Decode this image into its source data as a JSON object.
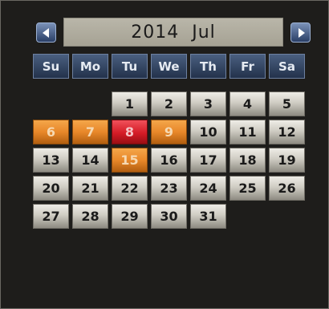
{
  "header": {
    "year": "2014",
    "month": "Jul"
  },
  "weekdays": [
    "Su",
    "Mo",
    "Tu",
    "We",
    "Th",
    "Fr",
    "Sa"
  ],
  "colors": {
    "highlight_orange": "#e8882a",
    "selected_red": "#d41c26"
  },
  "weeks": [
    [
      null,
      null,
      {
        "day": "1"
      },
      {
        "day": "2"
      },
      {
        "day": "3"
      },
      {
        "day": "4"
      },
      {
        "day": "5"
      }
    ],
    [
      {
        "day": "6",
        "state": "orange"
      },
      {
        "day": "7",
        "state": "orange"
      },
      {
        "day": "8",
        "state": "red"
      },
      {
        "day": "9",
        "state": "orange"
      },
      {
        "day": "10"
      },
      {
        "day": "11"
      },
      {
        "day": "12"
      }
    ],
    [
      {
        "day": "13"
      },
      {
        "day": "14"
      },
      {
        "day": "15",
        "state": "orange"
      },
      {
        "day": "16"
      },
      {
        "day": "17"
      },
      {
        "day": "18"
      },
      {
        "day": "19"
      }
    ],
    [
      {
        "day": "20"
      },
      {
        "day": "21"
      },
      {
        "day": "22"
      },
      {
        "day": "23"
      },
      {
        "day": "24"
      },
      {
        "day": "25"
      },
      {
        "day": "26"
      }
    ],
    [
      {
        "day": "27"
      },
      {
        "day": "28"
      },
      {
        "day": "29"
      },
      {
        "day": "30"
      },
      {
        "day": "31"
      },
      null,
      null
    ]
  ]
}
